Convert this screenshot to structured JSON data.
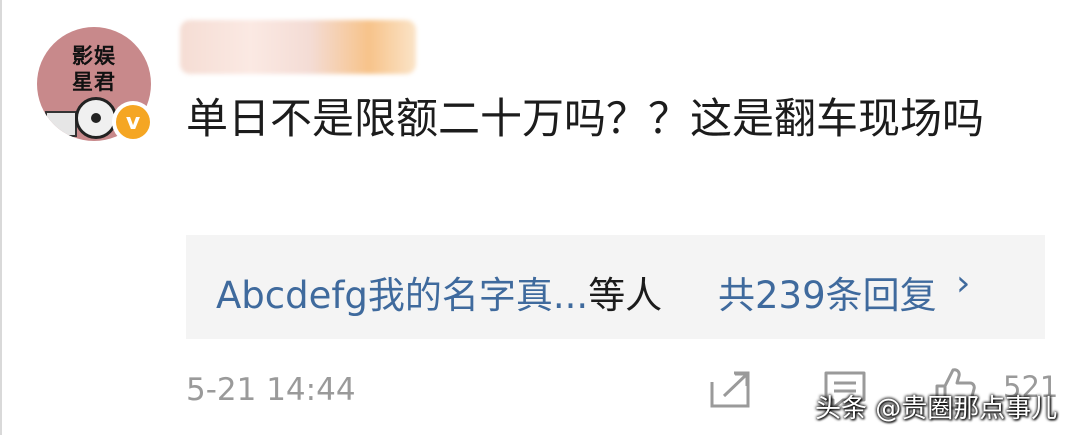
{
  "user": {
    "avatar_text_line1": "影娱",
    "avatar_text_line2": "星君",
    "verified_badge": "v",
    "verified_color": "#f5a623"
  },
  "comment": {
    "text": "单日不是限额二十万吗？？这是翻车现场吗"
  },
  "replies": {
    "names": "Abcdefg我的名字真...",
    "etc_label": "等人",
    "count_label": "共239条回复",
    "chevron": "›",
    "link_color": "#3f6a9d"
  },
  "footer": {
    "timestamp": "5-21 14:44",
    "share_icon": "share-icon",
    "comment_icon": "comment-icon",
    "like_icon": "like-icon",
    "like_count": "521"
  },
  "watermark": {
    "text": "头条 @贵圈那点事儿"
  }
}
